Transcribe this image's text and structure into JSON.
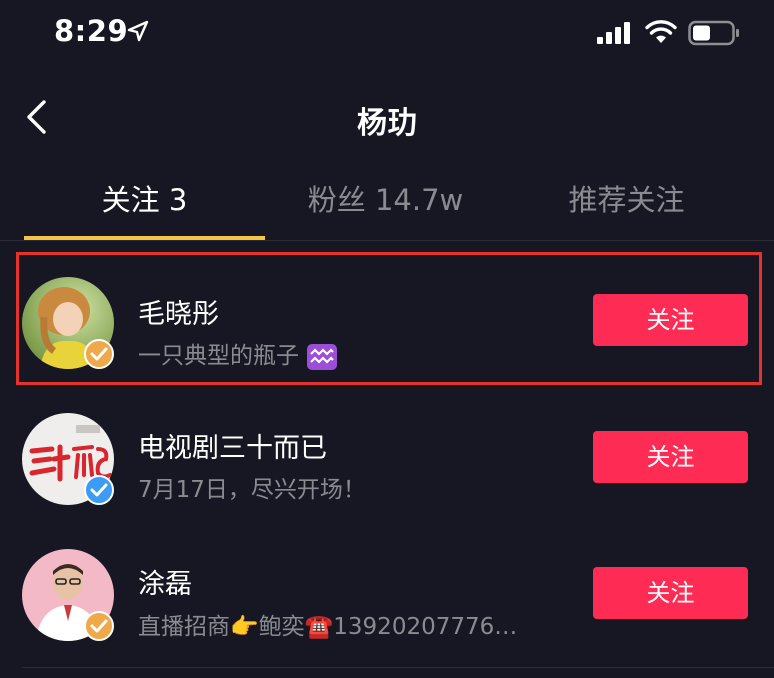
{
  "status_bar": {
    "time": "8:29"
  },
  "header": {
    "title": "杨玏"
  },
  "tabs": [
    {
      "label": "关注 3",
      "active": true
    },
    {
      "label": "粉丝 14.7w",
      "active": false
    },
    {
      "label": "推荐关注",
      "active": false
    }
  ],
  "users": [
    {
      "name": "毛晓彤",
      "bio": "一只典型的瓶子",
      "bio_emoji": "♒",
      "badge_color": "#f0a94a",
      "follow_label": "关注"
    },
    {
      "name": "电视剧三十而已",
      "bio": "7月17日，尽兴开场！",
      "badge_color": "#3b9cf5",
      "follow_label": "关注"
    },
    {
      "name": "涂磊",
      "bio_parts": [
        "直播招商",
        "👉",
        "鲍奕",
        "☎️",
        "13920207776…"
      ],
      "badge_color": "#f0a94a",
      "follow_label": "关注"
    }
  ],
  "colors": {
    "accent": "#fe2c55",
    "tab_indicator": "#f6c443",
    "background": "#161722",
    "highlight": "#e5322c"
  }
}
